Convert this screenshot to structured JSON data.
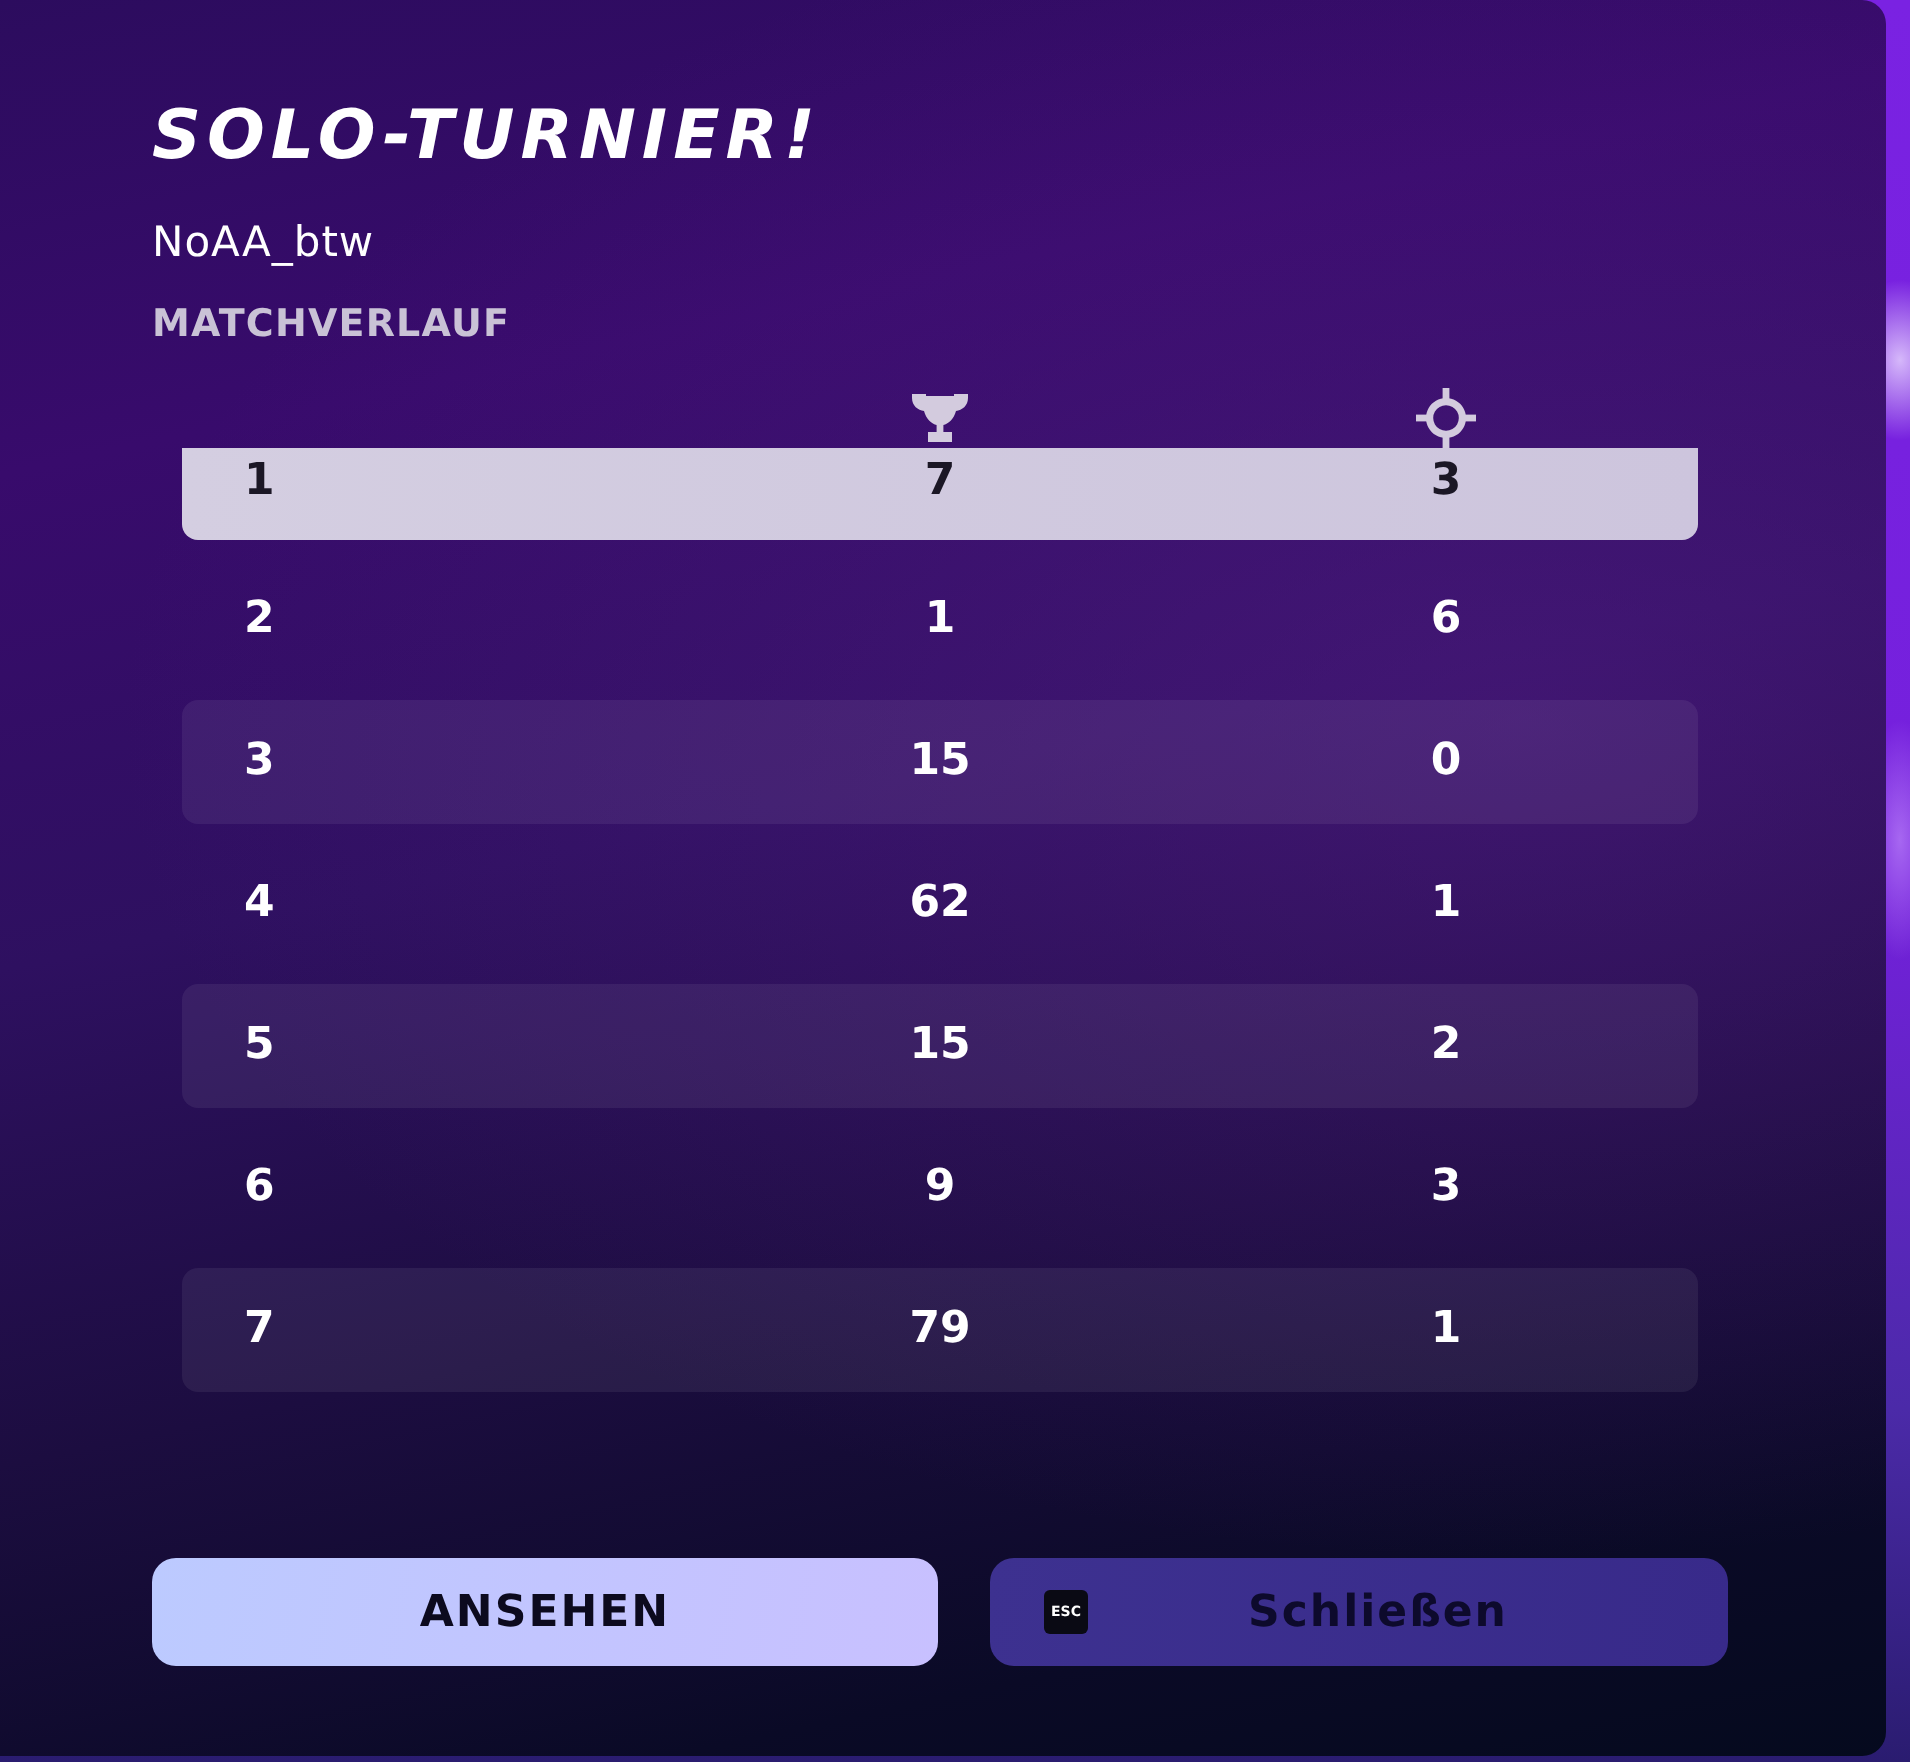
{
  "dialog": {
    "title": "SOLO-TURNIER!",
    "player": "NoAA_btw",
    "section_label": "MATCHVERLAUF"
  },
  "table": {
    "rows": [
      {
        "selected": true,
        "cells": [
          "1",
          "7",
          "3"
        ]
      },
      {
        "selected": false,
        "cells": [
          "2",
          "1",
          "6"
        ]
      },
      {
        "selected": false,
        "cells": [
          "3",
          "15",
          "0"
        ]
      },
      {
        "selected": false,
        "cells": [
          "4",
          "62",
          "1"
        ]
      },
      {
        "selected": false,
        "cells": [
          "5",
          "15",
          "2"
        ]
      },
      {
        "selected": false,
        "cells": [
          "6",
          "9",
          "3"
        ]
      },
      {
        "selected": false,
        "cells": [
          "7",
          "79",
          "1"
        ]
      }
    ]
  },
  "buttons": [
    {
      "kind": "primary",
      "label": "ANSEHEN"
    },
    {
      "kind": "secondary",
      "label": "Schließen",
      "key_hint": "ESC"
    }
  ]
}
